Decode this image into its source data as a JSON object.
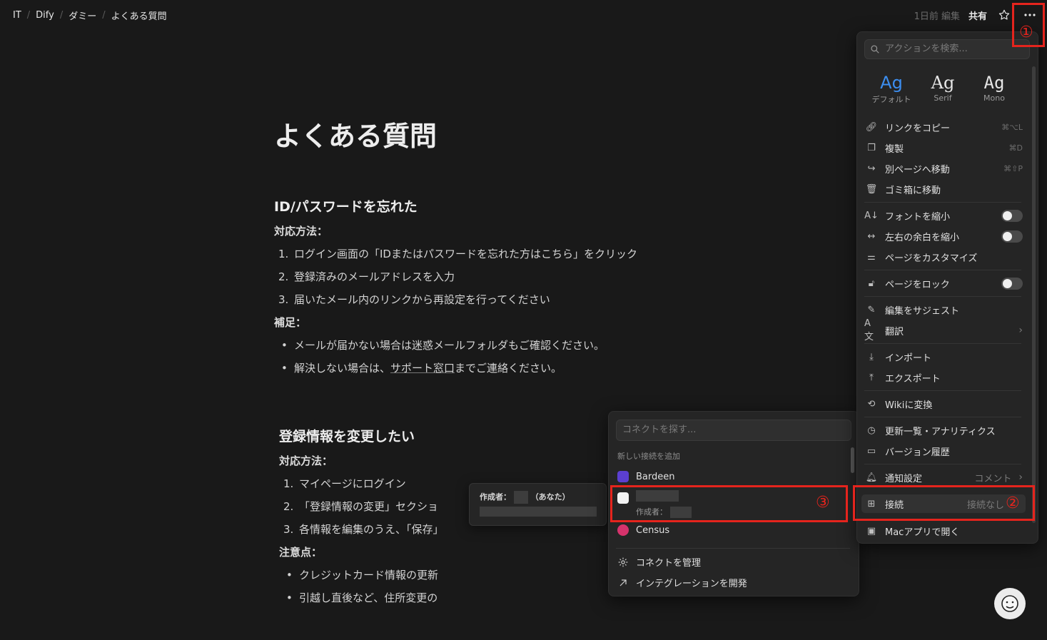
{
  "breadcrumbs": [
    "IT",
    "Dify",
    "ダミー",
    "よくある質問"
  ],
  "topbar": {
    "edited": "1日前 編集",
    "share": "共有"
  },
  "page": {
    "title": "よくある質問",
    "section1": {
      "heading": "ID/パスワードを忘れた",
      "method_label": "対応方法：",
      "steps": [
        "ログイン画面の「IDまたはパスワードを忘れた方はこちら」をクリック",
        "登録済みのメールアドレスを入力",
        "届いたメール内のリンクから再設定を行ってください"
      ],
      "note_label": "補足：",
      "bullet1": "メールが届かない場合は迷惑メールフォルダもご確認ください。",
      "bullet2_pre": "解決しない場合は、",
      "bullet2_link": "サポート窓口",
      "bullet2_post": "までご連絡ください。"
    },
    "section2": {
      "heading": "登録情報を変更したい",
      "method_label": "対応方法：",
      "steps": [
        "マイページにログイン",
        "「登録情報の変更」セクショ",
        "各情報を編集のうえ、「保存」"
      ],
      "note_label": "注意点：",
      "bullets": [
        "クレジットカード情報の更新",
        "引越し直後など、住所変更の"
      ]
    }
  },
  "menu": {
    "search_placeholder": "アクションを検索...",
    "fonts": [
      {
        "ag": "Ag",
        "caption": "デフォルト"
      },
      {
        "ag": "Ag",
        "caption": "Serif"
      },
      {
        "ag": "Ag",
        "caption": "Mono"
      }
    ],
    "copy_link": {
      "label": "リンクをコピー",
      "shortcut": "⌘⌥L"
    },
    "duplicate": {
      "label": "複製",
      "shortcut": "⌘D"
    },
    "move_to": {
      "label": "別ページへ移動",
      "shortcut": "⌘⇧P"
    },
    "trash": {
      "label": "ゴミ箱に移動"
    },
    "small_text": {
      "label": "フォントを縮小"
    },
    "full_width": {
      "label": "左右の余白を縮小"
    },
    "customize": {
      "label": "ページをカスタマイズ"
    },
    "lock": {
      "label": "ページをロック"
    },
    "suggest": {
      "label": "編集をサジェスト"
    },
    "translate": {
      "label": "翻訳"
    },
    "import": {
      "label": "インポート"
    },
    "export": {
      "label": "エクスポート"
    },
    "wiki": {
      "label": "Wikiに変換"
    },
    "updates": {
      "label": "更新一覧・アナリティクス"
    },
    "versions": {
      "label": "バージョン履歴"
    },
    "notify": {
      "label": "通知設定",
      "value": "コメント"
    },
    "connections": {
      "label": "接続",
      "value": "接続なし"
    },
    "mac_app": {
      "label": "Macアプリで開く"
    }
  },
  "connect_menu": {
    "search_placeholder": "コネクトを探す...",
    "section_label": "新しい接続を追加",
    "bardeen": "Bardeen",
    "redacted_creator_label": "作成者：",
    "census": "Census",
    "manage": "コネクトを管理",
    "develop": "インテグレーションを開発"
  },
  "tooltip": {
    "creator_label": "作成者：",
    "you": "（あなた）"
  },
  "annotations": {
    "one": "①",
    "two": "②",
    "three": "③"
  },
  "colors": {
    "background": "#191919",
    "accent": "#3c8ef0",
    "annotation": "#e5241d"
  }
}
